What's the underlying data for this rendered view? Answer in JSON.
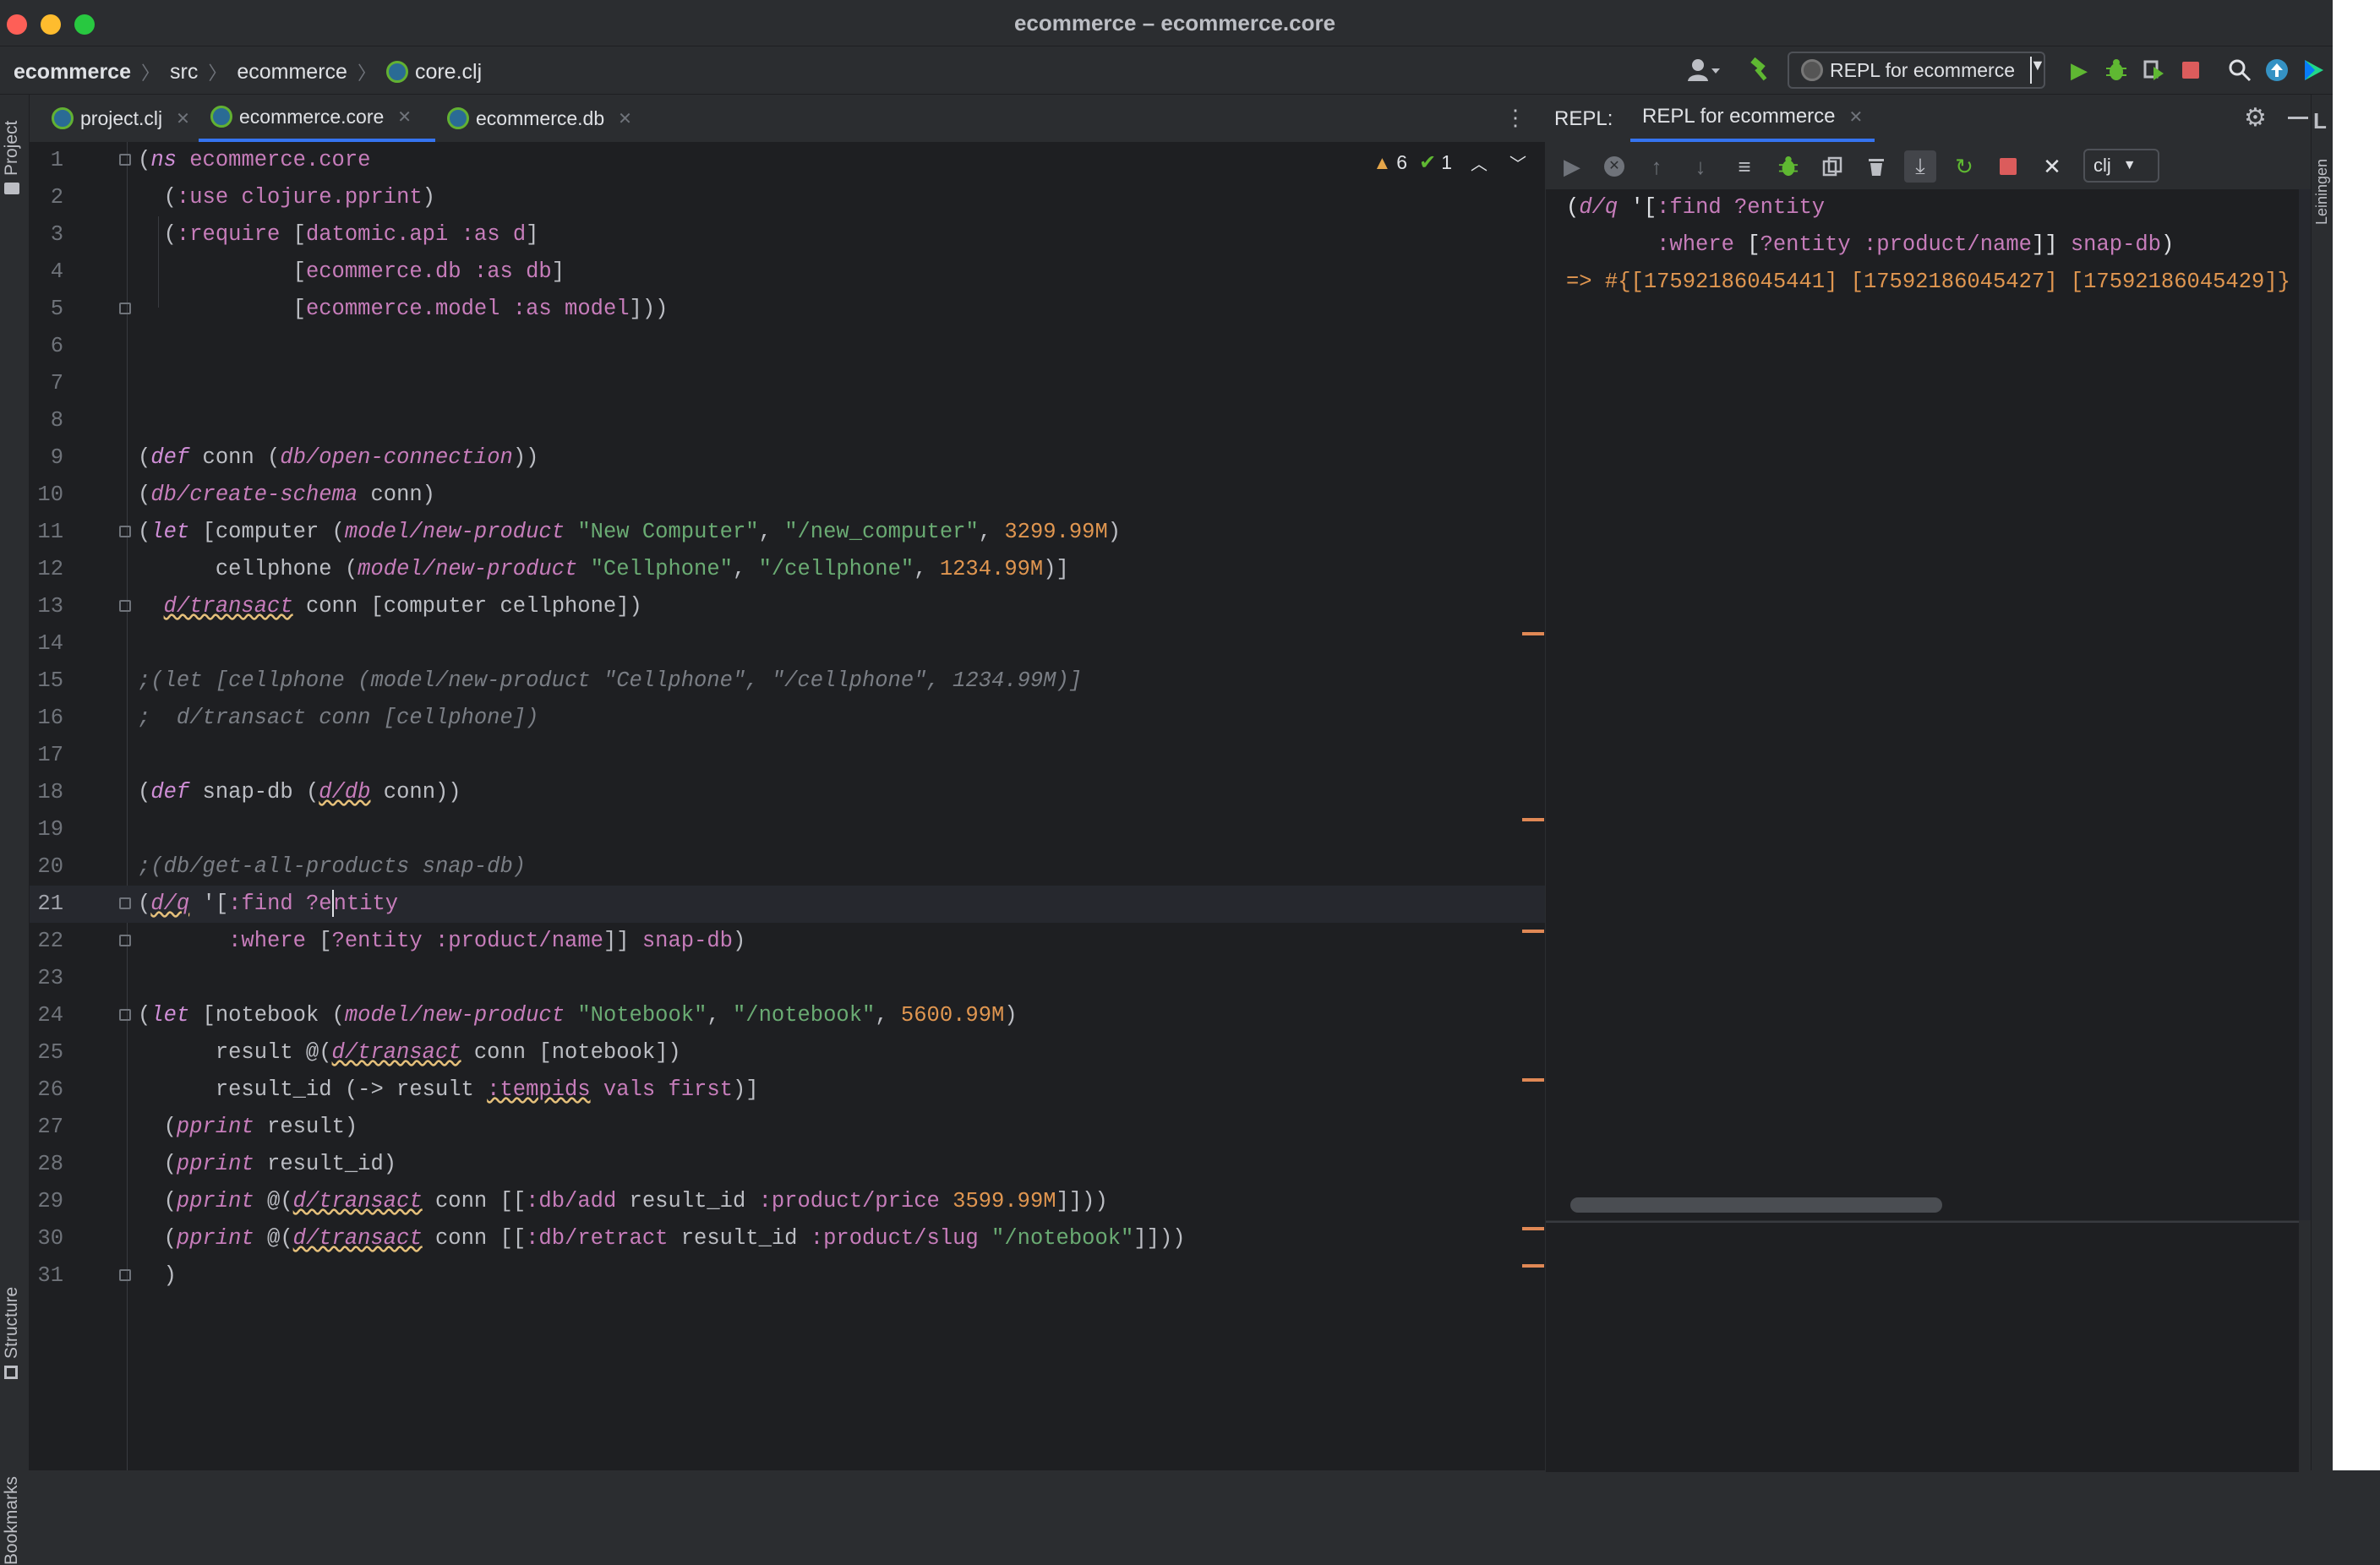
{
  "window": {
    "title": "ecommerce – ecommerce.core"
  },
  "breadcrumbs": [
    "ecommerce",
    "src",
    "ecommerce",
    "core.clj"
  ],
  "run_config": {
    "label": "REPL for ecommerce"
  },
  "left_strip": {
    "project": "Project",
    "structure": "Structure",
    "bookmarks": "Bookmarks"
  },
  "right_strip": {
    "leiningen": "Leiningen"
  },
  "editor_tabs": [
    {
      "label": "project.clj",
      "active": false
    },
    {
      "label": "ecommerce.core",
      "active": true
    },
    {
      "label": "ecommerce.db",
      "active": false
    }
  ],
  "inspections": {
    "warnings": "6",
    "weak_warnings": "1"
  },
  "repl": {
    "prefix": "REPL:",
    "tab_label": "REPL for ecommerce",
    "language": "clj",
    "output_result": "=> #{[17592186045441] [17592186045427] [17592186045429]}"
  },
  "code_lines": [
    {
      "n": "1"
    },
    {
      "n": "2"
    },
    {
      "n": "3"
    },
    {
      "n": "4"
    },
    {
      "n": "5"
    },
    {
      "n": "6"
    },
    {
      "n": "7"
    },
    {
      "n": "8"
    },
    {
      "n": "9"
    },
    {
      "n": "10"
    },
    {
      "n": "11"
    },
    {
      "n": "12"
    },
    {
      "n": "13"
    },
    {
      "n": "14"
    },
    {
      "n": "15"
    },
    {
      "n": "16"
    },
    {
      "n": "17"
    },
    {
      "n": "18"
    },
    {
      "n": "19"
    },
    {
      "n": "20"
    },
    {
      "n": "21"
    },
    {
      "n": "22"
    },
    {
      "n": "23"
    },
    {
      "n": "24"
    },
    {
      "n": "25"
    },
    {
      "n": "26"
    },
    {
      "n": "27"
    },
    {
      "n": "28"
    },
    {
      "n": "29"
    },
    {
      "n": "30"
    },
    {
      "n": "31"
    }
  ],
  "colors": {
    "accent": "#3574f0",
    "warning": "#e08855",
    "run": "#5fb832",
    "stop": "#db5c5c"
  }
}
